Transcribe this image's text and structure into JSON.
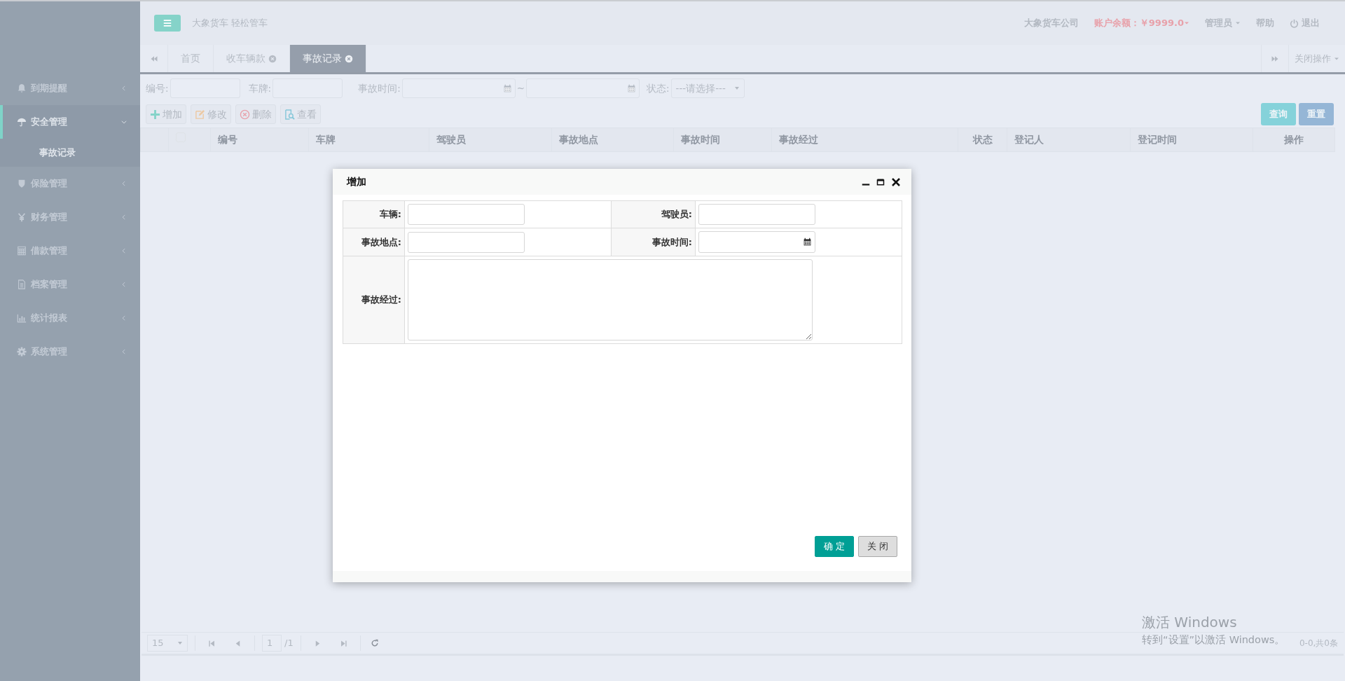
{
  "header": {
    "brand": "大象货车 轻松管车",
    "company": "大象货车公司",
    "balance": "账户余额：￥9999.0",
    "user": "管理员",
    "help": "帮助",
    "logout": "退出"
  },
  "sidebar": {
    "items": [
      {
        "label": "到期提醒",
        "expanded": false
      },
      {
        "label": "安全管理",
        "expanded": true,
        "children": [
          {
            "label": "事故记录",
            "selected": true
          }
        ]
      },
      {
        "label": "保险管理",
        "expanded": false
      },
      {
        "label": "财务管理",
        "expanded": false
      },
      {
        "label": "借款管理",
        "expanded": false
      },
      {
        "label": "档案管理",
        "expanded": false
      },
      {
        "label": "统计报表",
        "expanded": false
      },
      {
        "label": "系统管理",
        "expanded": false
      }
    ]
  },
  "tabs": [
    {
      "label": "首页",
      "closable": false,
      "selected": false
    },
    {
      "label": "收车辆款",
      "closable": true,
      "selected": false
    },
    {
      "label": "事故记录",
      "closable": true,
      "selected": true
    }
  ],
  "tab_menu": "关闭操作",
  "filters": [
    {
      "label": "编号:",
      "kind": "text"
    },
    {
      "label": "车牌:",
      "kind": "text"
    },
    {
      "label": "事故时间:",
      "kind": "daterange",
      "separator": "~"
    },
    {
      "label": "状态:",
      "kind": "select",
      "value": "---请选择---"
    }
  ],
  "toolbar": [
    {
      "label": "增加"
    },
    {
      "label": "修改"
    },
    {
      "label": "删除"
    },
    {
      "label": "查看"
    }
  ],
  "search_buttons": [
    {
      "label": "查询",
      "kind": "query"
    },
    {
      "label": "重置",
      "kind": "reset"
    }
  ],
  "table": {
    "select_all_checked": false,
    "columns": [
      "编号",
      "车牌",
      "驾驶员",
      "事故地点",
      "事故时间",
      "事故经过",
      "状态",
      "登记人",
      "登记时间",
      "操作"
    ]
  },
  "pager": {
    "page_size": "15",
    "page": "1",
    "total_pages": "/1",
    "summary": "0-0,共0条"
  },
  "dialog": {
    "title": "增加",
    "fields": [
      {
        "label": "车辆:",
        "kind": "text"
      },
      {
        "label": "驾驶员:",
        "kind": "text"
      },
      {
        "label": "事故地点:",
        "kind": "text"
      },
      {
        "label": "事故时间:",
        "kind": "date"
      },
      {
        "label": "事故经过:",
        "kind": "textarea"
      }
    ],
    "buttons": [
      {
        "label": "确 定",
        "kind": "primary"
      },
      {
        "label": "关 闭",
        "kind": "default"
      }
    ]
  },
  "os_notice": {
    "title": "激活 Windows",
    "text": "转到“设置”以激活 Windows。"
  }
}
